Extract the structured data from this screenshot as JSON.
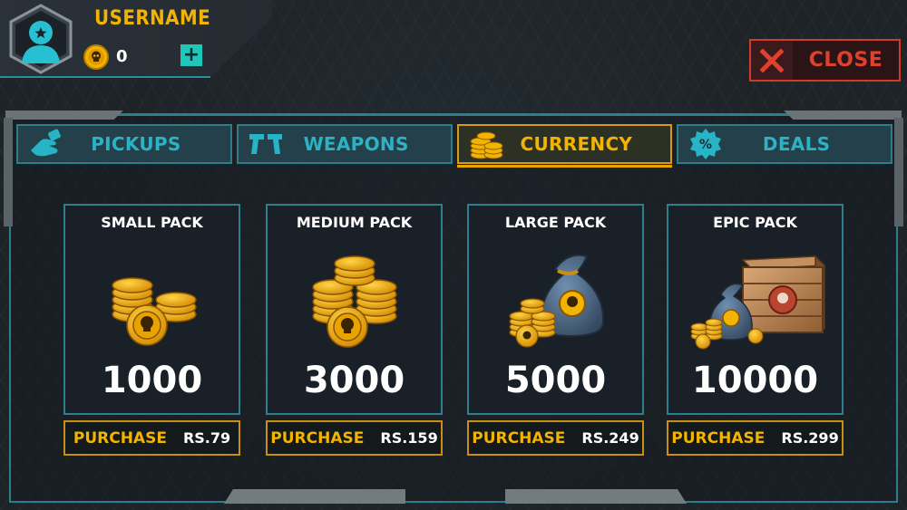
{
  "header": {
    "username": "USERNAME",
    "currency_count": "0",
    "add_label": "+"
  },
  "close_button": {
    "label": "CLOSE"
  },
  "tabs": [
    {
      "label": "PICKUPS",
      "icon": "pickup-hand-icon",
      "active": false
    },
    {
      "label": "WEAPONS",
      "icon": "pistols-icon",
      "active": false
    },
    {
      "label": "CURRENCY",
      "icon": "coin-stack-icon",
      "active": true
    },
    {
      "label": "DEALS",
      "icon": "percent-badge-icon",
      "active": false
    }
  ],
  "packs": [
    {
      "title": "SMALL PACK",
      "amount": "1000",
      "purchase_label": "PURCHASE",
      "price": "RS.79",
      "art": "coin-stacks-icon"
    },
    {
      "title": "MEDIUM PACK",
      "amount": "3000",
      "purchase_label": "PURCHASE",
      "price": "RS.159",
      "art": "coin-pile-icon"
    },
    {
      "title": "LARGE PACK",
      "amount": "5000",
      "purchase_label": "PURCHASE",
      "price": "RS.249",
      "art": "money-bag-icon"
    },
    {
      "title": "EPIC PACK",
      "amount": "10000",
      "purchase_label": "PURCHASE",
      "price": "RS.299",
      "art": "crate-icon"
    }
  ],
  "colors": {
    "accent_gold": "#f2b400",
    "accent_teal": "#2bb2c4",
    "close_red": "#e0402e",
    "background": "#1e2328"
  }
}
